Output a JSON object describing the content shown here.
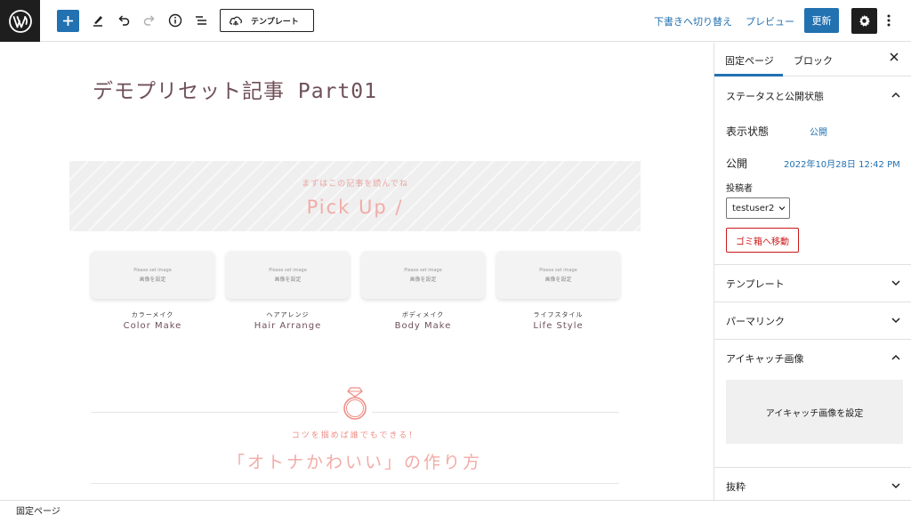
{
  "toolbar": {
    "template_label": "テンプレート",
    "switch_draft_label": "下書きへ切り替え",
    "preview_label": "プレビュー",
    "update_label": "更新",
    "icons": [
      "wordpress-logo",
      "plus-icon",
      "pen-icon",
      "undo-icon",
      "redo-icon",
      "info-icon",
      "list-view-icon",
      "template-icon",
      "gear-icon",
      "more-icon"
    ],
    "accent_color": "#2271b1"
  },
  "canvas": {
    "post_title": "デモプリセット記事 Part01",
    "pickup": {
      "subtitle": "まずはこの記事を読んでね",
      "title": "Pick Up /"
    },
    "cards": [
      {
        "placeholder_en": "Please set image",
        "placeholder_jp": "画像を設定",
        "label_jp": "カラーメイク",
        "label_en": "Color Make"
      },
      {
        "placeholder_en": "Please set image",
        "placeholder_jp": "画像を設定",
        "label_jp": "ヘアアレンジ",
        "label_en": "Hair Arrange"
      },
      {
        "placeholder_en": "Please set image",
        "placeholder_jp": "画像を設定",
        "label_jp": "ボディメイク",
        "label_en": "Body Make"
      },
      {
        "placeholder_en": "Please set image",
        "placeholder_jp": "画像を設定",
        "label_jp": "ライフスタイル",
        "label_en": "Life Style"
      }
    ],
    "section": {
      "subtitle": "コツを掴めば誰でもできる！",
      "title": "「オトナかわいい」の作り方"
    },
    "title_color": "#6f5058",
    "accent_pink": "#f2aba6"
  },
  "sidebar": {
    "tabs": [
      "固定ページ",
      "ブロック"
    ],
    "status_panel": {
      "title": "ステータスと公開状態",
      "visibility_label": "表示状態",
      "visibility_value": "公開",
      "publish_label": "公開",
      "publish_value": "2022年10月28日 12:42 PM",
      "author_label": "投稿者",
      "author_value": "testuser2",
      "trash_label": "ゴミ箱へ移動"
    },
    "template_panel": {
      "title": "テンプレート"
    },
    "permalink_panel": {
      "title": "パーマリンク"
    },
    "featured_panel": {
      "title": "アイキャッチ画像",
      "set_label": "アイキャッチ画像を設定"
    },
    "excerpt_panel": {
      "title": "抜粋"
    }
  },
  "footer": {
    "breadcrumb": "固定ページ"
  }
}
